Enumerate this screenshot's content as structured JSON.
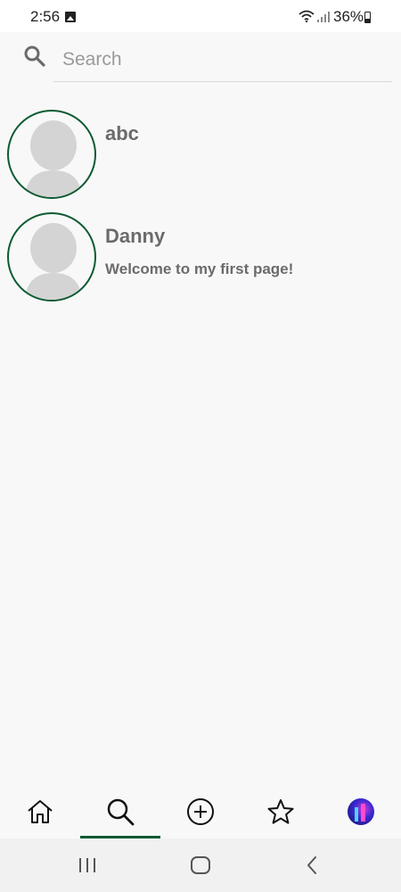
{
  "status_bar": {
    "time": "2:56",
    "battery": "36%",
    "icons": [
      "image-icon",
      "wifi-icon",
      "signal-icon",
      "battery-icon"
    ]
  },
  "search": {
    "placeholder": "Search",
    "value": ""
  },
  "users": [
    {
      "name": "abc",
      "bio": ""
    },
    {
      "name": "Danny",
      "bio": "Welcome to my first page!"
    }
  ],
  "tab_bar": {
    "tabs": [
      {
        "id": "home",
        "icon": "home-icon"
      },
      {
        "id": "search",
        "icon": "search-icon",
        "active": true
      },
      {
        "id": "add",
        "icon": "add-circle-icon"
      },
      {
        "id": "favorites",
        "icon": "star-icon"
      },
      {
        "id": "profile",
        "icon": "profile-avatar"
      }
    ]
  },
  "system_nav": {
    "buttons": [
      "recents-icon",
      "home-circle-icon",
      "back-icon"
    ]
  },
  "colors": {
    "accent": "#0d5a32",
    "background": "#f8f8f8",
    "text_secondary": "#6b6b6b",
    "placeholder": "#9a9a9a"
  }
}
